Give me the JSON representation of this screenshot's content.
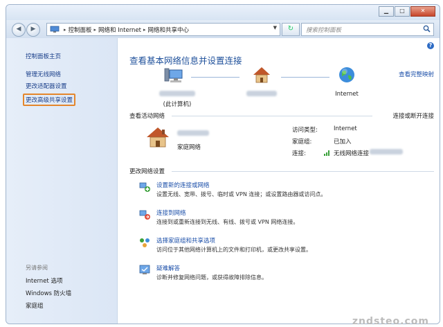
{
  "window": {
    "btn_min": "▁",
    "btn_max": "□",
    "btn_close": "✕"
  },
  "nav": {
    "back": "◀",
    "forward": "▶",
    "breadcrumb": [
      "控制面板",
      "网络和 Internet",
      "网络和共享中心"
    ],
    "search_placeholder": "搜索控制面板"
  },
  "sidebar": {
    "home": "控制面板主页",
    "items": [
      "管理无线网络",
      "更改适配器设置",
      "更改高级共享设置"
    ],
    "see_also_heading": "另请参阅",
    "see_also": [
      "Internet 选项",
      "Windows 防火墙",
      "家庭组"
    ]
  },
  "main": {
    "title": "查看基本网络信息并设置连接",
    "view_full_map": "查看完整映射",
    "map": {
      "computer_label": "(此计算机)",
      "internet_label": "Internet"
    },
    "active_networks": {
      "heading": "查看活动网络",
      "connect_link": "连接或断开连接",
      "network_type": "家庭网络",
      "access_type_label": "访问类型:",
      "access_type_value": "Internet",
      "homegroup_label": "家庭组:",
      "homegroup_value": "已加入",
      "connection_label": "连接:",
      "connection_value": "无线网络连接"
    },
    "change_settings": {
      "heading": "更改网络设置",
      "tasks": [
        {
          "title": "设置新的连接或网络",
          "desc": "设置无线、宽带、拨号、临时或 VPN 连接；或设置路由器或访问点。"
        },
        {
          "title": "连接到网络",
          "desc": "连接到或重新连接到无线、有线、拨号或 VPN 网络连接。"
        },
        {
          "title": "选择家庭组和共享选项",
          "desc": "访问位于其他网络计算机上的文件和打印机，或更改共享设置。"
        },
        {
          "title": "疑难解答",
          "desc": "诊断并修复网络问题，或获得故障排除信息。"
        }
      ]
    }
  },
  "watermark": "zndsteo.com",
  "colors": {
    "link": "#1a4ea8",
    "highlight_border": "#e4862b",
    "title": "#1d4f9a"
  }
}
